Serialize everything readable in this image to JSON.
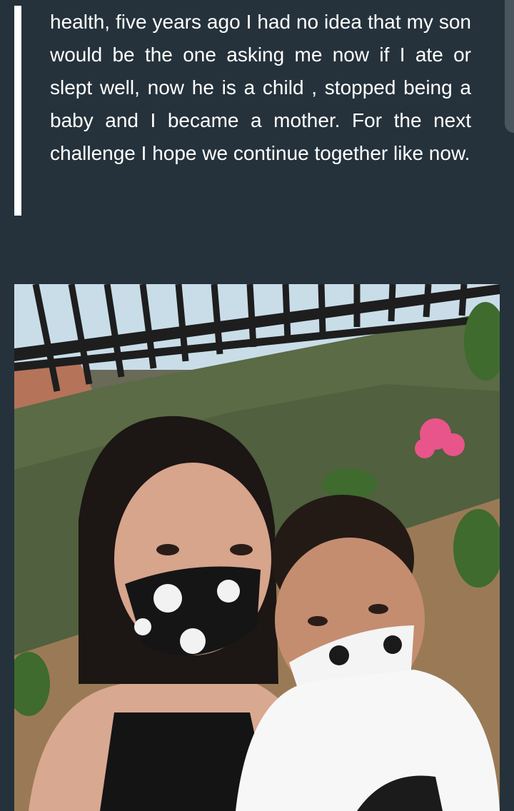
{
  "post": {
    "quote_text": "health, five years ago I had no idea that my son would be the one asking me now if I ate or slept well, now he is a child , stopped being a baby and I became a mother. For the next challenge I hope we continue together like now."
  },
  "photo": {
    "alt": "Mother and son selfie wearing skull-print face masks"
  },
  "colors": {
    "background": "#25323b",
    "text": "#ffffff",
    "quote_bar": "#ffffff"
  }
}
